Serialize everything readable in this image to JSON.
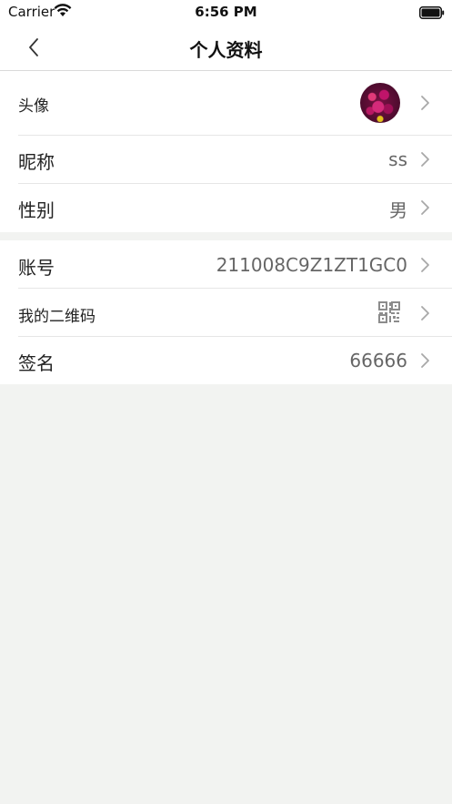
{
  "status_bar": {
    "carrier": "Carrier",
    "time": "6:56 PM",
    "icons": [
      "wifi-icon",
      "battery-icon"
    ]
  },
  "nav": {
    "title": "个人资料",
    "back_icon": "chevron-left-icon"
  },
  "profile": {
    "avatar_label": "头像",
    "nickname_label": "昵称",
    "nickname_value": "ss",
    "gender_label": "性别",
    "gender_value": "男",
    "account_label": "账号",
    "account_value": "211008C9Z1ZT1GC0",
    "qrcode_label": "我的二维码",
    "qrcode_icon": "qrcode-icon",
    "signature_label": "签名",
    "signature_value": "66666"
  },
  "colors": {
    "background": "#f2f3f1",
    "row_background": "#ffffff",
    "chevron": "#a8a8a8",
    "value_text": "#666666"
  }
}
